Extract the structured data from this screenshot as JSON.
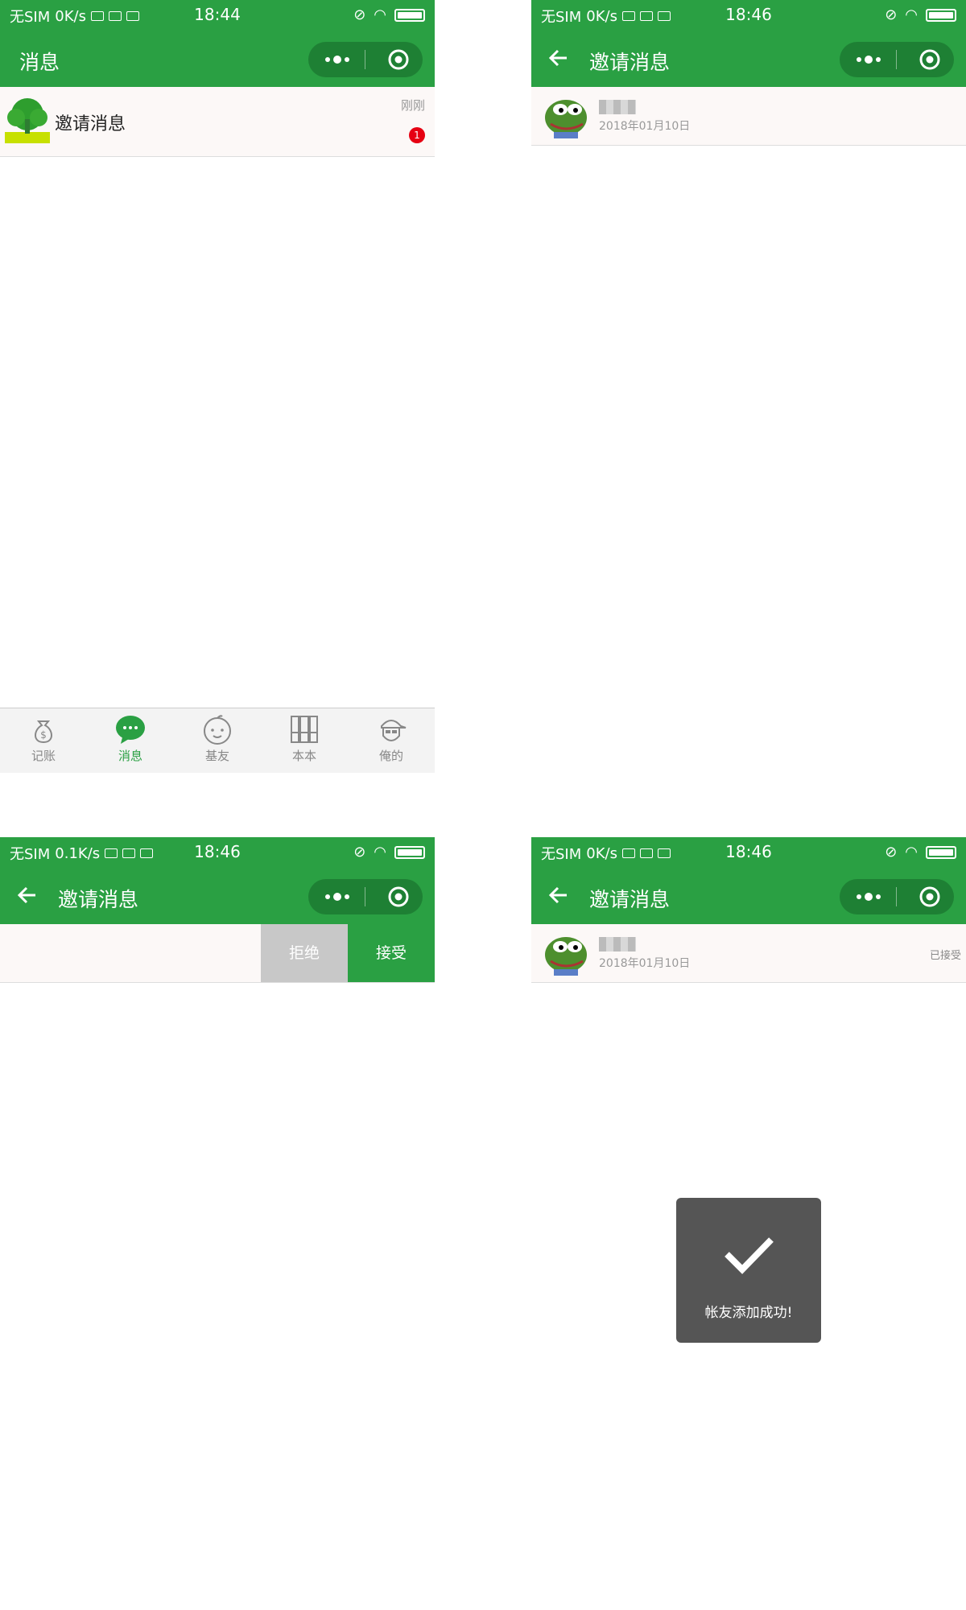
{
  "screens": [
    {
      "status": {
        "carrier": "无SIM",
        "speed": "0K/s",
        "time": "18:44"
      },
      "nav_title": "消息",
      "list": [
        {
          "title": "邀请消息",
          "time": "刚刚",
          "badge": "1"
        }
      ],
      "tabs": [
        {
          "label": "记账",
          "icon": "money-bag-icon"
        },
        {
          "label": "消息",
          "icon": "chat-bubble-icon",
          "active": true
        },
        {
          "label": "基友",
          "icon": "baby-face-icon"
        },
        {
          "label": "本本",
          "icon": "books-icon"
        },
        {
          "label": "俺的",
          "icon": "cap-face-icon"
        }
      ]
    },
    {
      "status": {
        "carrier": "无SIM",
        "speed": "0K/s",
        "time": "18:46"
      },
      "nav_title": "邀请消息",
      "item": {
        "date": "2018年01月10日"
      }
    },
    {
      "status": {
        "carrier": "无SIM",
        "speed": "0.1K/s",
        "time": "18:46"
      },
      "nav_title": "邀请消息",
      "actions": {
        "reject": "拒绝",
        "accept": "接受"
      }
    },
    {
      "status": {
        "carrier": "无SIM",
        "speed": "0K/s",
        "time": "18:46"
      },
      "nav_title": "邀请消息",
      "item": {
        "date": "2018年01月10日",
        "status": "已接受"
      },
      "toast": "帐友添加成功!"
    }
  ],
  "colors": {
    "primary": "#2aa043",
    "capsule": "#1e8034",
    "badge": "#e60012",
    "row_bg": "#fcf8f7",
    "reject_bg": "#c8c8c8"
  }
}
